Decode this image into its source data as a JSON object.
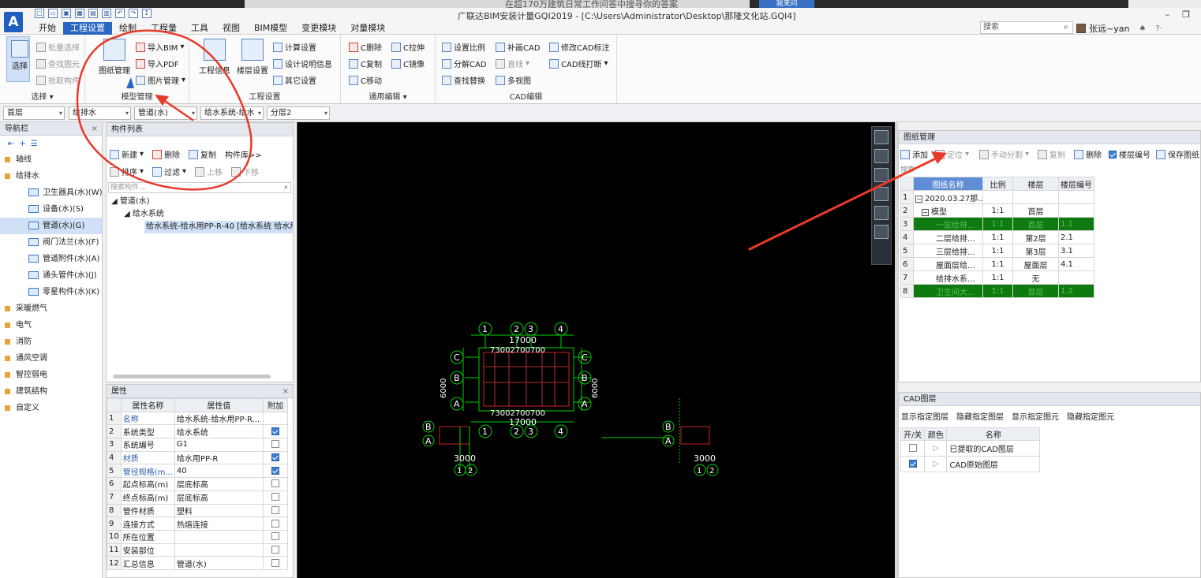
{
  "top_strip": {
    "banner_text": "在超170万建筑日常工作问答中搜寻你的答案",
    "banner_button": "我来问"
  },
  "app": {
    "logo": "A",
    "title": "广联达BIM安装计量GQI2019 - [C:\\Users\\Administrator\\Desktop\\那隆文化站.GQI4]",
    "menu_tabs": [
      "开始",
      "工程设置",
      "绘制",
      "工程量",
      "工具",
      "视图",
      "BIM模型",
      "变更模块",
      "对量模块"
    ],
    "active_tab": "工程设置",
    "search_placeholder": "搜索",
    "user_name": "张远~yan",
    "help": "?·",
    "qat_icons": [
      "new-icon",
      "open-icon",
      "save-icon",
      "grid-icon",
      "calc-icon",
      "report-icon",
      "undo-icon",
      "redo-icon",
      "sum-icon"
    ]
  },
  "ribbon": {
    "select_group": {
      "label": "选择",
      "select_btn": "选择",
      "batch_select": "批量选择",
      "find_element": "查找图元",
      "pick_component": "拾取构件"
    },
    "model_group": {
      "label": "模型管理",
      "drawing_mgmt": "图纸管理",
      "import_bim": "导入BIM",
      "import_pdf": "导入PDF",
      "image_mgmt": "图片管理"
    },
    "project_group": {
      "label": "工程设置",
      "project_info": "工程信息",
      "floor_settings": "楼层设置",
      "calc_settings": "计算设置",
      "design_notes": "设计说明信息",
      "other_settings": "其它设置"
    },
    "edit_group": {
      "label": "通用编辑",
      "delete": "C删除",
      "copy": "C复制",
      "move": "C移动",
      "stretch": "C拉伸",
      "mirror": "C镜像"
    },
    "cad_group": {
      "label": "CAD编辑",
      "set_scale": "设置比例",
      "split_cad": "分解CAD",
      "find_replace": "查找替换",
      "draw_cad": "补画CAD",
      "line": "直线",
      "multi_view": "多视图",
      "modify_cad_label": "修改CAD标注",
      "cad_break": "CAD线打断"
    }
  },
  "selectors": [
    "首层",
    "给排水",
    "管道(水)",
    "给水系统-给水",
    "分层2"
  ],
  "nav": {
    "title": "导航栏",
    "categories": [
      "轴线",
      "给排水",
      "采暖燃气",
      "电气",
      "消防",
      "通风空调",
      "智控弱电",
      "建筑结构",
      "自定义"
    ],
    "sub_items": [
      "卫生器具(水)(W)",
      "设备(水)(S)",
      "管道(水)(G)",
      "阀门法兰(水)(F)",
      "管道附件(水)(A)",
      "通头管件(水)(J)",
      "零星构件(水)(K)"
    ],
    "active_sub": "管道(水)(G)"
  },
  "component_list": {
    "title": "构件列表",
    "toolbar": {
      "new": "新建",
      "delete": "删除",
      "copy": "复制",
      "library": "构件库>>",
      "sort": "排序",
      "filter": "过滤",
      "move_up": "上移",
      "move_down": "下移"
    },
    "search_placeholder": "搜索构件...",
    "tree": {
      "root": "管道(水)",
      "system": "给水系统",
      "item": "给水系统-给水用PP-R-40 [给水系统 给水用PP-R 40]"
    }
  },
  "properties": {
    "title": "属性",
    "headers": [
      "属性名称",
      "属性值",
      "附加"
    ],
    "rows": [
      {
        "no": "1",
        "name": "名称",
        "value": "给水系统-给水用PP-R...",
        "blue": true,
        "check": null
      },
      {
        "no": "2",
        "name": "系统类型",
        "value": "给水系统",
        "blue": false,
        "check": true
      },
      {
        "no": "3",
        "name": "系统编号",
        "value": "G1",
        "blue": false,
        "check": false
      },
      {
        "no": "4",
        "name": "材质",
        "value": "给水用PP-R",
        "blue": true,
        "check": true
      },
      {
        "no": "5",
        "name": "管径规格(m...",
        "value": "40",
        "blue": true,
        "check": true
      },
      {
        "no": "6",
        "name": "起点标高(m)",
        "value": "层底标高",
        "blue": false,
        "check": false
      },
      {
        "no": "7",
        "name": "终点标高(m)",
        "value": "层底标高",
        "blue": false,
        "check": false
      },
      {
        "no": "8",
        "name": "管件材质",
        "value": "塑料",
        "blue": false,
        "check": false
      },
      {
        "no": "9",
        "name": "连接方式",
        "value": "热熔连接",
        "blue": false,
        "check": false
      },
      {
        "no": "10",
        "name": "所在位置",
        "value": "",
        "blue": false,
        "check": false
      },
      {
        "no": "11",
        "name": "安装部位",
        "value": "",
        "blue": false,
        "check": false
      },
      {
        "no": "12",
        "name": "汇总信息",
        "value": "管道(水)",
        "blue": false,
        "check": false
      }
    ]
  },
  "canvas": {
    "axis_labels": [
      "1",
      "2",
      "3",
      "4",
      "A",
      "B",
      "C"
    ],
    "dims": [
      "17000",
      "73002700700",
      "6000",
      "3000",
      "1",
      "2",
      "B",
      "A"
    ]
  },
  "drawing_mgmt": {
    "title": "图纸管理",
    "toolbar": {
      "add": "添加",
      "locate": "定位",
      "manual_split": "手动分割",
      "copy": "复制",
      "delete": "删除",
      "floor_no": "楼层编号",
      "save": "保存图纸"
    },
    "search_hint": "搜索",
    "headers": [
      "图纸名称",
      "比例",
      "楼层",
      "楼层编号"
    ],
    "rows": [
      {
        "no": "1",
        "name": "2020.03.27那...",
        "scale": "",
        "floor": "",
        "code": "",
        "green": false,
        "collapse": true
      },
      {
        "no": "2",
        "name": "模型",
        "scale": "1:1",
        "floor": "首层",
        "code": "",
        "green": false,
        "collapse": true
      },
      {
        "no": "3",
        "name": "一层给排...",
        "scale": "1:1",
        "floor": "首层",
        "code": "1.1",
        "green": true,
        "collapse": false
      },
      {
        "no": "4",
        "name": "二层给排...",
        "scale": "1:1",
        "floor": "第2层",
        "code": "2.1",
        "green": false,
        "collapse": false
      },
      {
        "no": "5",
        "name": "三层给排...",
        "scale": "1:1",
        "floor": "第3层",
        "code": "3.1",
        "green": false,
        "collapse": false
      },
      {
        "no": "6",
        "name": "屋面层给...",
        "scale": "1:1",
        "floor": "屋面层",
        "code": "4.1",
        "green": false,
        "collapse": false
      },
      {
        "no": "7",
        "name": "给排水系...",
        "scale": "1:1",
        "floor": "无",
        "code": "",
        "green": false,
        "collapse": false
      },
      {
        "no": "8",
        "name": "卫生间大...",
        "scale": "1:1",
        "floor": "首层",
        "code": "1.2",
        "green": true,
        "collapse": false
      }
    ]
  },
  "cad_layers": {
    "title": "CAD图层",
    "actions": [
      "显示指定图层",
      "隐藏指定图层",
      "显示指定图元",
      "隐藏指定图元"
    ],
    "headers": [
      "开/关",
      "颜色",
      "名称"
    ],
    "rows": [
      {
        "name": "已提取的CAD图层",
        "on": false
      },
      {
        "name": "CAD原始图层",
        "on": true
      }
    ]
  },
  "colors": {
    "accent": "#2a67c5",
    "highlight_green": "#0f7a0f",
    "annotation_red": "#e83a2a",
    "cad_green": "#00e000"
  }
}
